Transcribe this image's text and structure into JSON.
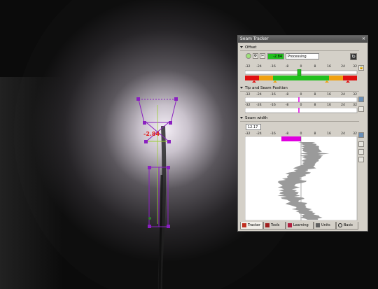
{
  "panel": {
    "title": "Seam Tracker",
    "offset": {
      "header": "Offset",
      "value": "-2.84",
      "status": "Processing",
      "scale_labels": [
        "-32",
        "-24",
        "-16",
        "-8",
        "0",
        "8",
        "16",
        "24",
        "32"
      ]
    },
    "tip_seam": {
      "header": "Tip and Seam Position",
      "scale_labels": [
        "-32",
        "-24",
        "-16",
        "-8",
        "0",
        "8",
        "16",
        "24",
        "32"
      ]
    },
    "seam_width": {
      "header": "Seam width",
      "value": "12.17",
      "scale_labels": [
        "-32",
        "-24",
        "-16",
        "-8",
        "0",
        "8",
        "16",
        "24",
        "32"
      ]
    },
    "tabs": [
      "Tracker",
      "Tools",
      "Learning",
      "Units",
      "Basic"
    ]
  },
  "overlay": {
    "offset_label": "-2.84"
  },
  "colors": {
    "accent_green": "#22c01e",
    "red": "#e01010",
    "orange": "#f0a010",
    "magenta": "#e000e0",
    "overlay_purple": "#8a20c0"
  }
}
